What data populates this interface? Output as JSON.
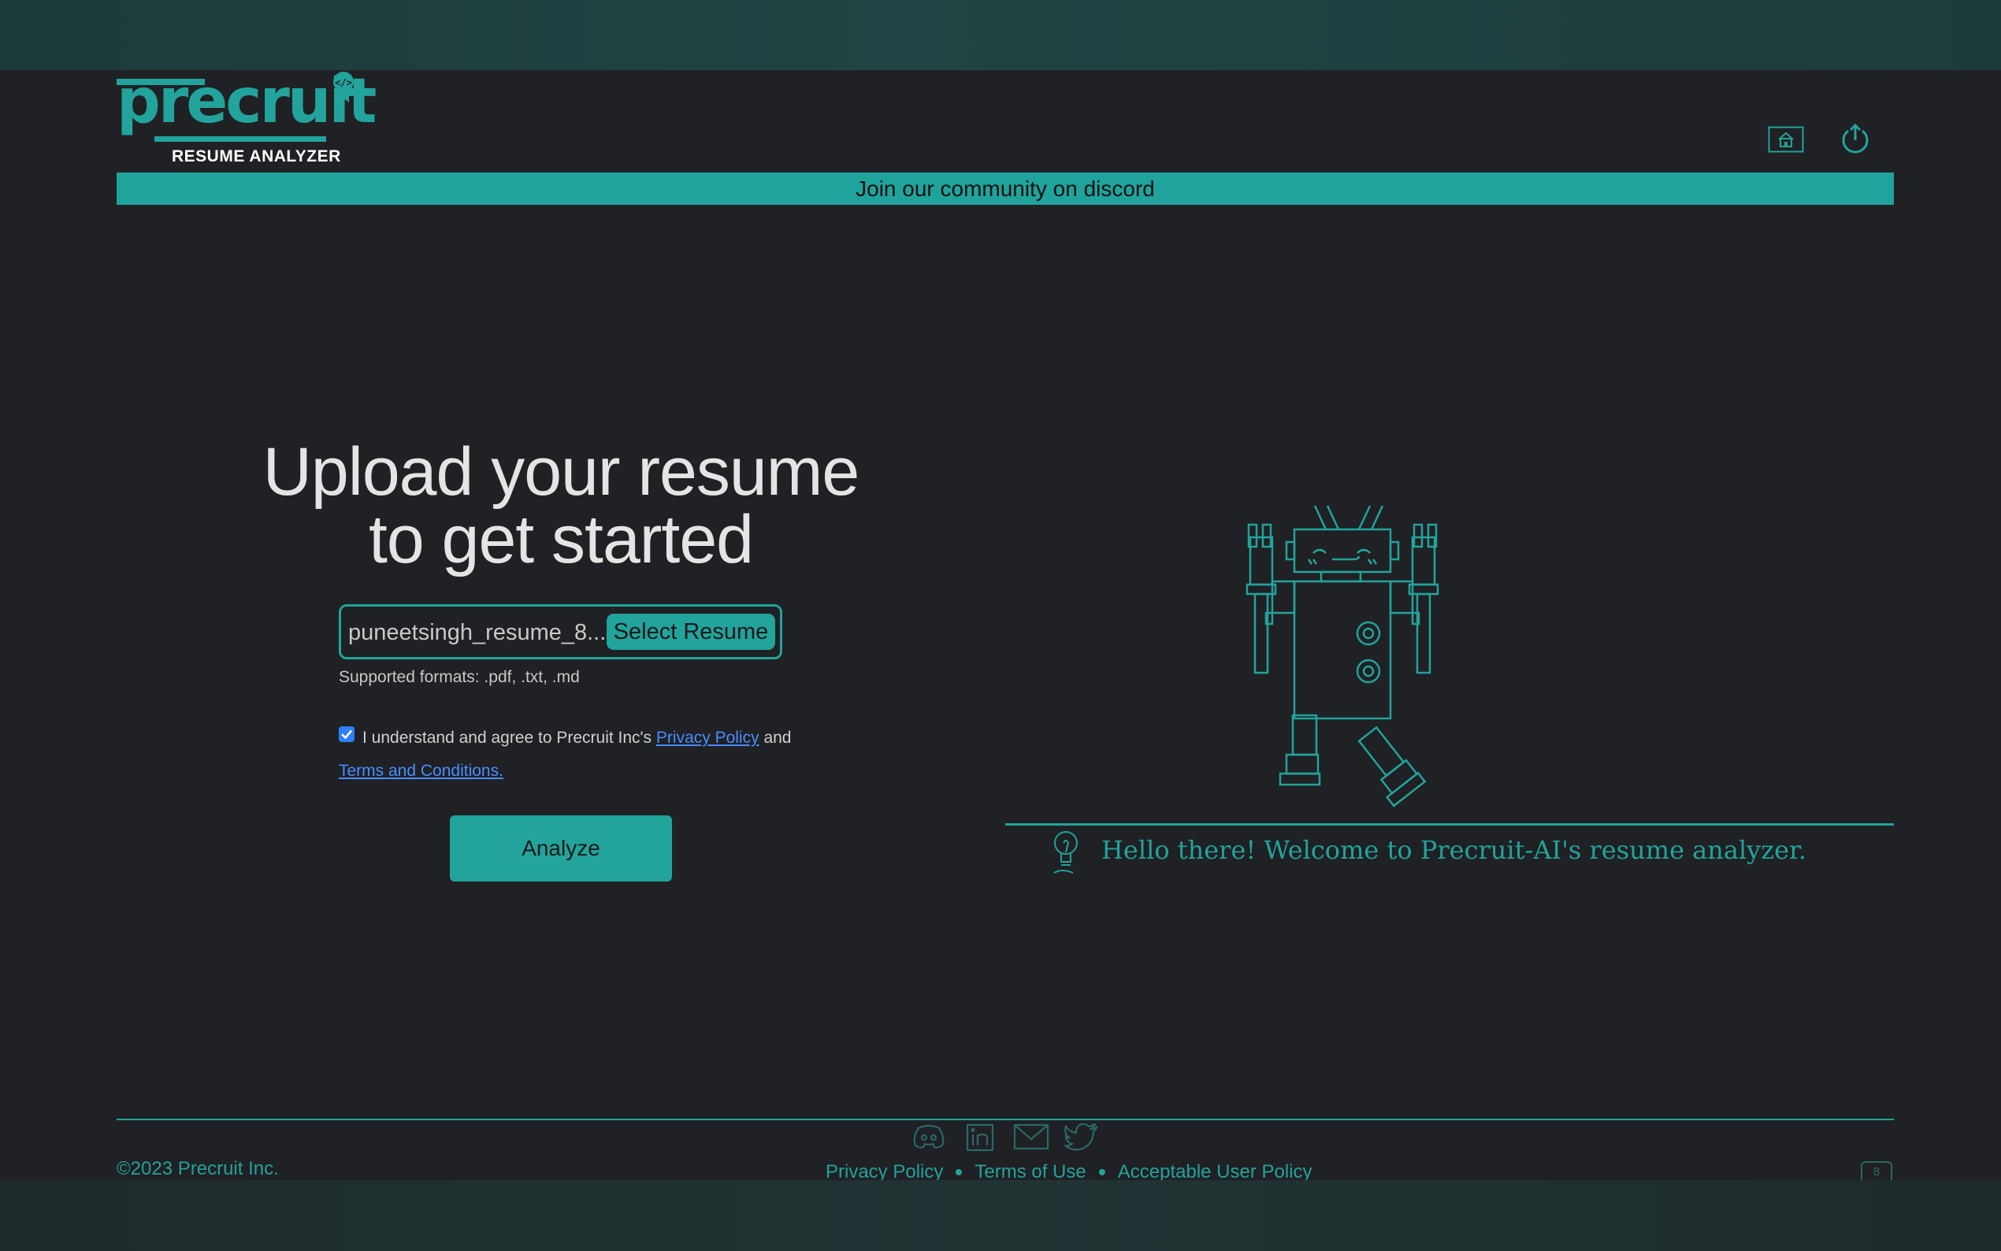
{
  "header": {
    "logo_text": "precruit",
    "logo_subtitle": "RESUME ANALYZER",
    "home_icon": "home-icon",
    "upload_icon": "power-upload-icon",
    "banner": "Join our community on discord"
  },
  "upload": {
    "heading_line1": "Upload your resume",
    "heading_line2": "to get started",
    "file_name": "puneetsingh_resume_8...",
    "select_button": "Select Resume",
    "formats": "Supported formats: .pdf, .txt, .md",
    "agree_checked": true,
    "agree_text": "I understand and agree to Precruit Inc's",
    "privacy_link": "Privacy Policy",
    "and_text": "and",
    "terms_link": "Terms and Conditions.",
    "analyze_button": "Analyze"
  },
  "welcome": {
    "message": "Hello there! Welcome to Precruit-AI's resume analyzer."
  },
  "footer": {
    "copyright": "©2023 Precruit Inc.",
    "social_icons": [
      "discord-icon",
      "linkedin-icon",
      "mail-icon",
      "twitter-icon"
    ],
    "links": [
      "Privacy Policy",
      "Terms of Use",
      "Acceptable User Policy"
    ],
    "page_badge": "8"
  },
  "colors": {
    "accent": "#22a39b",
    "background": "#1f2124",
    "link": "#4a8cff"
  }
}
